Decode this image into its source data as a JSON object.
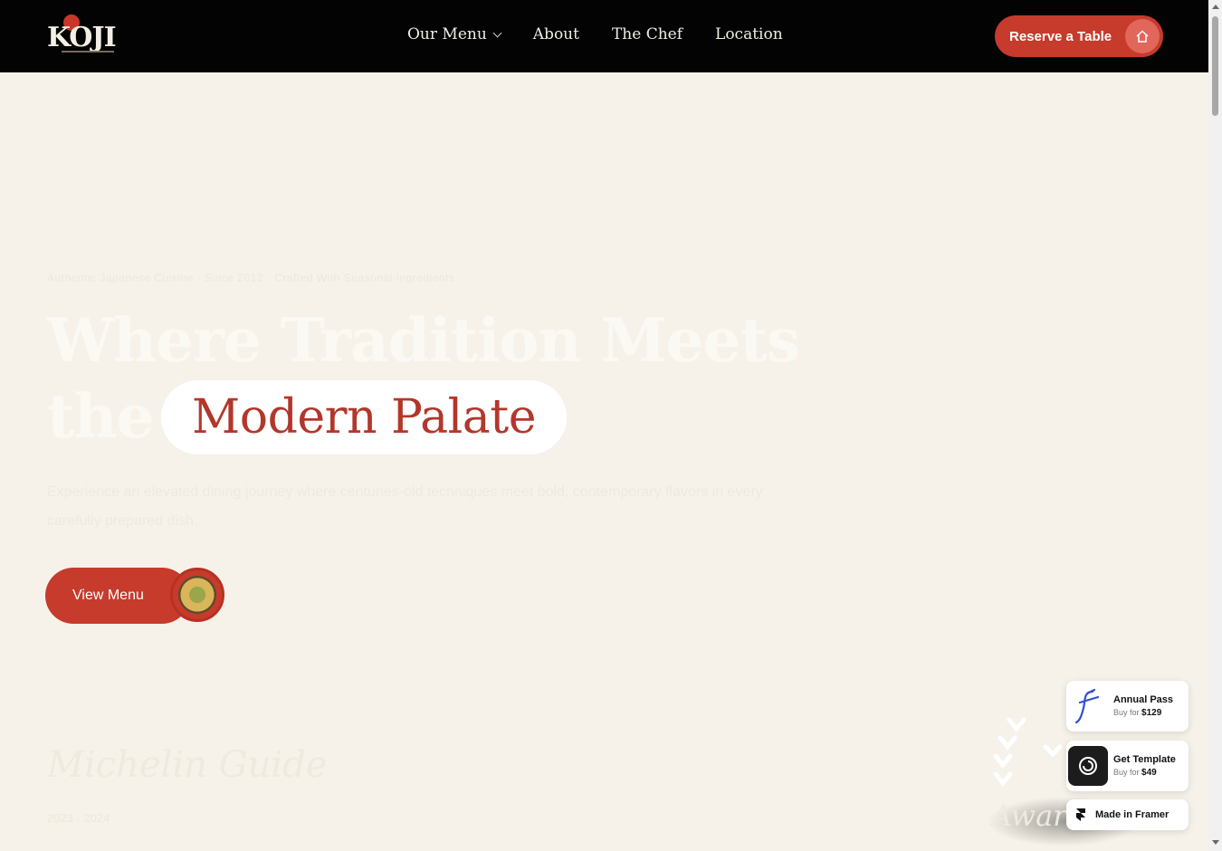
{
  "nav": {
    "logo_text": "KOJI",
    "links": [
      "Our Menu",
      "About",
      "The Chef",
      "Location"
    ],
    "cta": "Reserve a Table"
  },
  "hero": {
    "eyebrow": "Authentic Japanese Cuisine · Since 2012 · Crafted With Seasonal Ingredients",
    "title_line1": "Where Tradition Meets",
    "title_line2_prefix": "the",
    "title_highlight": "Modern Palate",
    "subtitle": "Experience an elevated dining journey where centuries-old techniques meet bold, contemporary flavors in every carefully prepared dish.",
    "button": "View Menu"
  },
  "accolade": {
    "script": "Michelin Guide",
    "sub": "2023 · 2024",
    "laurel_word": "Award"
  },
  "badges": {
    "annual_title": "Annual Pass",
    "annual_price_prefix": "Buy for",
    "annual_price": "$129",
    "template_title": "Get Template",
    "template_price_prefix": "Buy for",
    "template_price": "$49",
    "framer": "Made in Framer"
  },
  "colors": {
    "nav_bg": "#030303",
    "accent": "#c63b2c",
    "page_bg": "#f6f2ea"
  }
}
